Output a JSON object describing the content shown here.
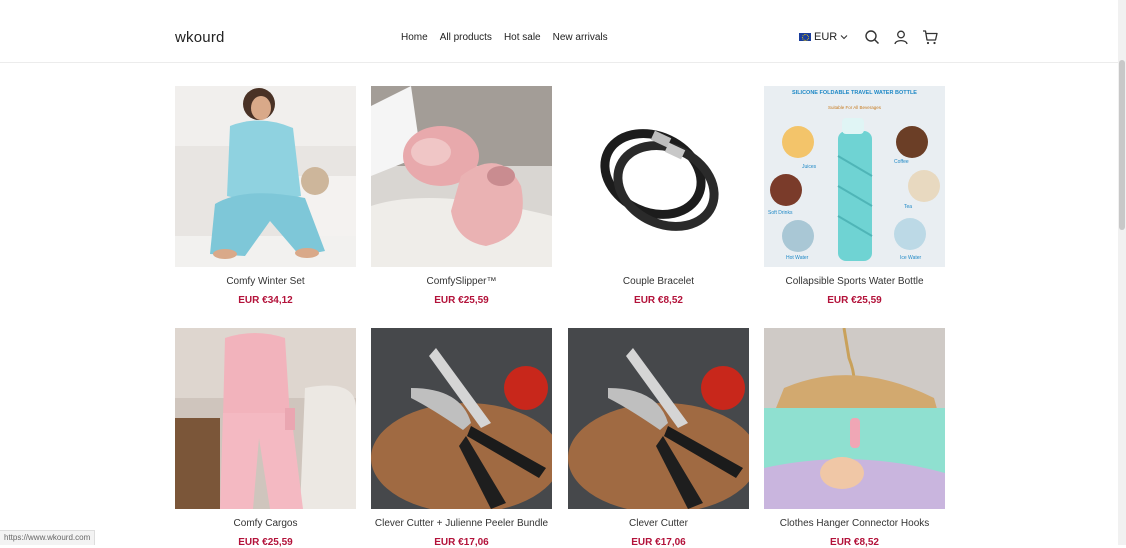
{
  "header": {
    "logo": "wkourd",
    "nav": [
      "Home",
      "All products",
      "Hot sale",
      "New arrivals"
    ],
    "currency": "EUR"
  },
  "icons": {
    "search": "search-icon",
    "account": "user-icon",
    "cart": "cart-icon",
    "currency_chevron": "chevron-down-icon"
  },
  "colors": {
    "price": "#b3123a"
  },
  "products": [
    {
      "title": "Comfy Winter Set",
      "price": "EUR €34,12"
    },
    {
      "title": "ComfySlipper™",
      "price": "EUR €25,59"
    },
    {
      "title": "Couple Bracelet",
      "price": "EUR €8,52"
    },
    {
      "title": "Collapsible Sports Water Bottle",
      "price": "EUR €25,59",
      "image_text": {
        "heading": "SILICONE FOLDABLE TRAVEL WATER BOTTLE",
        "sub": "Suitable For All Beverages",
        "labels": [
          "Juices",
          "Coffee",
          "Tea",
          "Soft Drinks",
          "Hot Water",
          "Ice Water"
        ]
      }
    },
    {
      "title": "Comfy Cargos",
      "price": "EUR €25,59"
    },
    {
      "title": "Clever Cutter + Julienne Peeler Bundle",
      "price": "EUR €17,06"
    },
    {
      "title": "Clever Cutter",
      "price": "EUR €17,06"
    },
    {
      "title": "Clothes Hanger Connector Hooks",
      "price": "EUR €8,52"
    }
  ],
  "status_url": "https://www.wkourd.com"
}
